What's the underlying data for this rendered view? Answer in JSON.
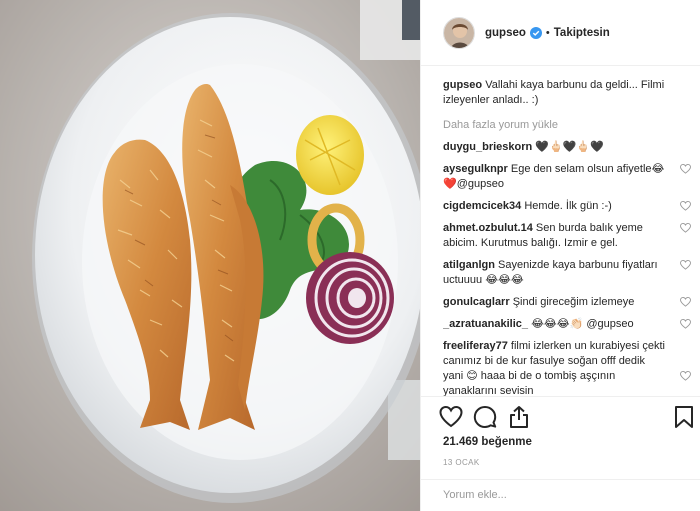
{
  "header": {
    "username": "gupseo",
    "separator": "•",
    "follow_status": "Takiptesin"
  },
  "caption": {
    "username": "gupseo",
    "text": "Vallahi kaya barbunu da geldi... Filmi izleyenler anladı.. :)"
  },
  "load_more": "Daha fazla yorum yükle",
  "comments": [
    {
      "username": "duygu_brieskorn",
      "text": "🖤🖕🏻🖤🖕🏻🖤"
    },
    {
      "username": "aysegulknpr",
      "text": "Ege den selam olsun afiyetle😂❤️@gupseo"
    },
    {
      "username": "cigdemcicek34",
      "text": "Hemde. İlk gün :-)"
    },
    {
      "username": "ahmet.ozbulut.14",
      "text": "Sen burda balık yeme abicim. Kurutmus balığı. Izmir e gel."
    },
    {
      "username": "atilganlgn",
      "text": "Sayenizde kaya barbunu fiyatları uctuuuu 😂😂😂"
    },
    {
      "username": "gonulcaglarr",
      "text": "Şindi gireceğim izlemeye"
    },
    {
      "username": "_azratuanakilic_",
      "text": "😂😂😂👏🏻 @gupseo"
    },
    {
      "username": "freeliferay77",
      "text": "filmi izlerken un kurabiyesi çekti canımız bi de kur fasulye soğan offf dedik yani 😊 haaa bi de o tombiş aşçının yanaklarını sevisin"
    }
  ],
  "actions": {
    "likes": "21.469 beğenme",
    "date": "13 OCAK"
  },
  "add_comment": {
    "placeholder": "Yorum ekle..."
  },
  "icons": {
    "verified": "verified-badge-icon",
    "like": "heart-icon",
    "comment": "comment-icon",
    "share": "share-icon",
    "save": "bookmark-icon",
    "comment_like": "small-heart-icon"
  },
  "colors": {
    "verified": "#3897f0",
    "muted": "#999999",
    "text": "#262626",
    "border": "#efefef"
  }
}
